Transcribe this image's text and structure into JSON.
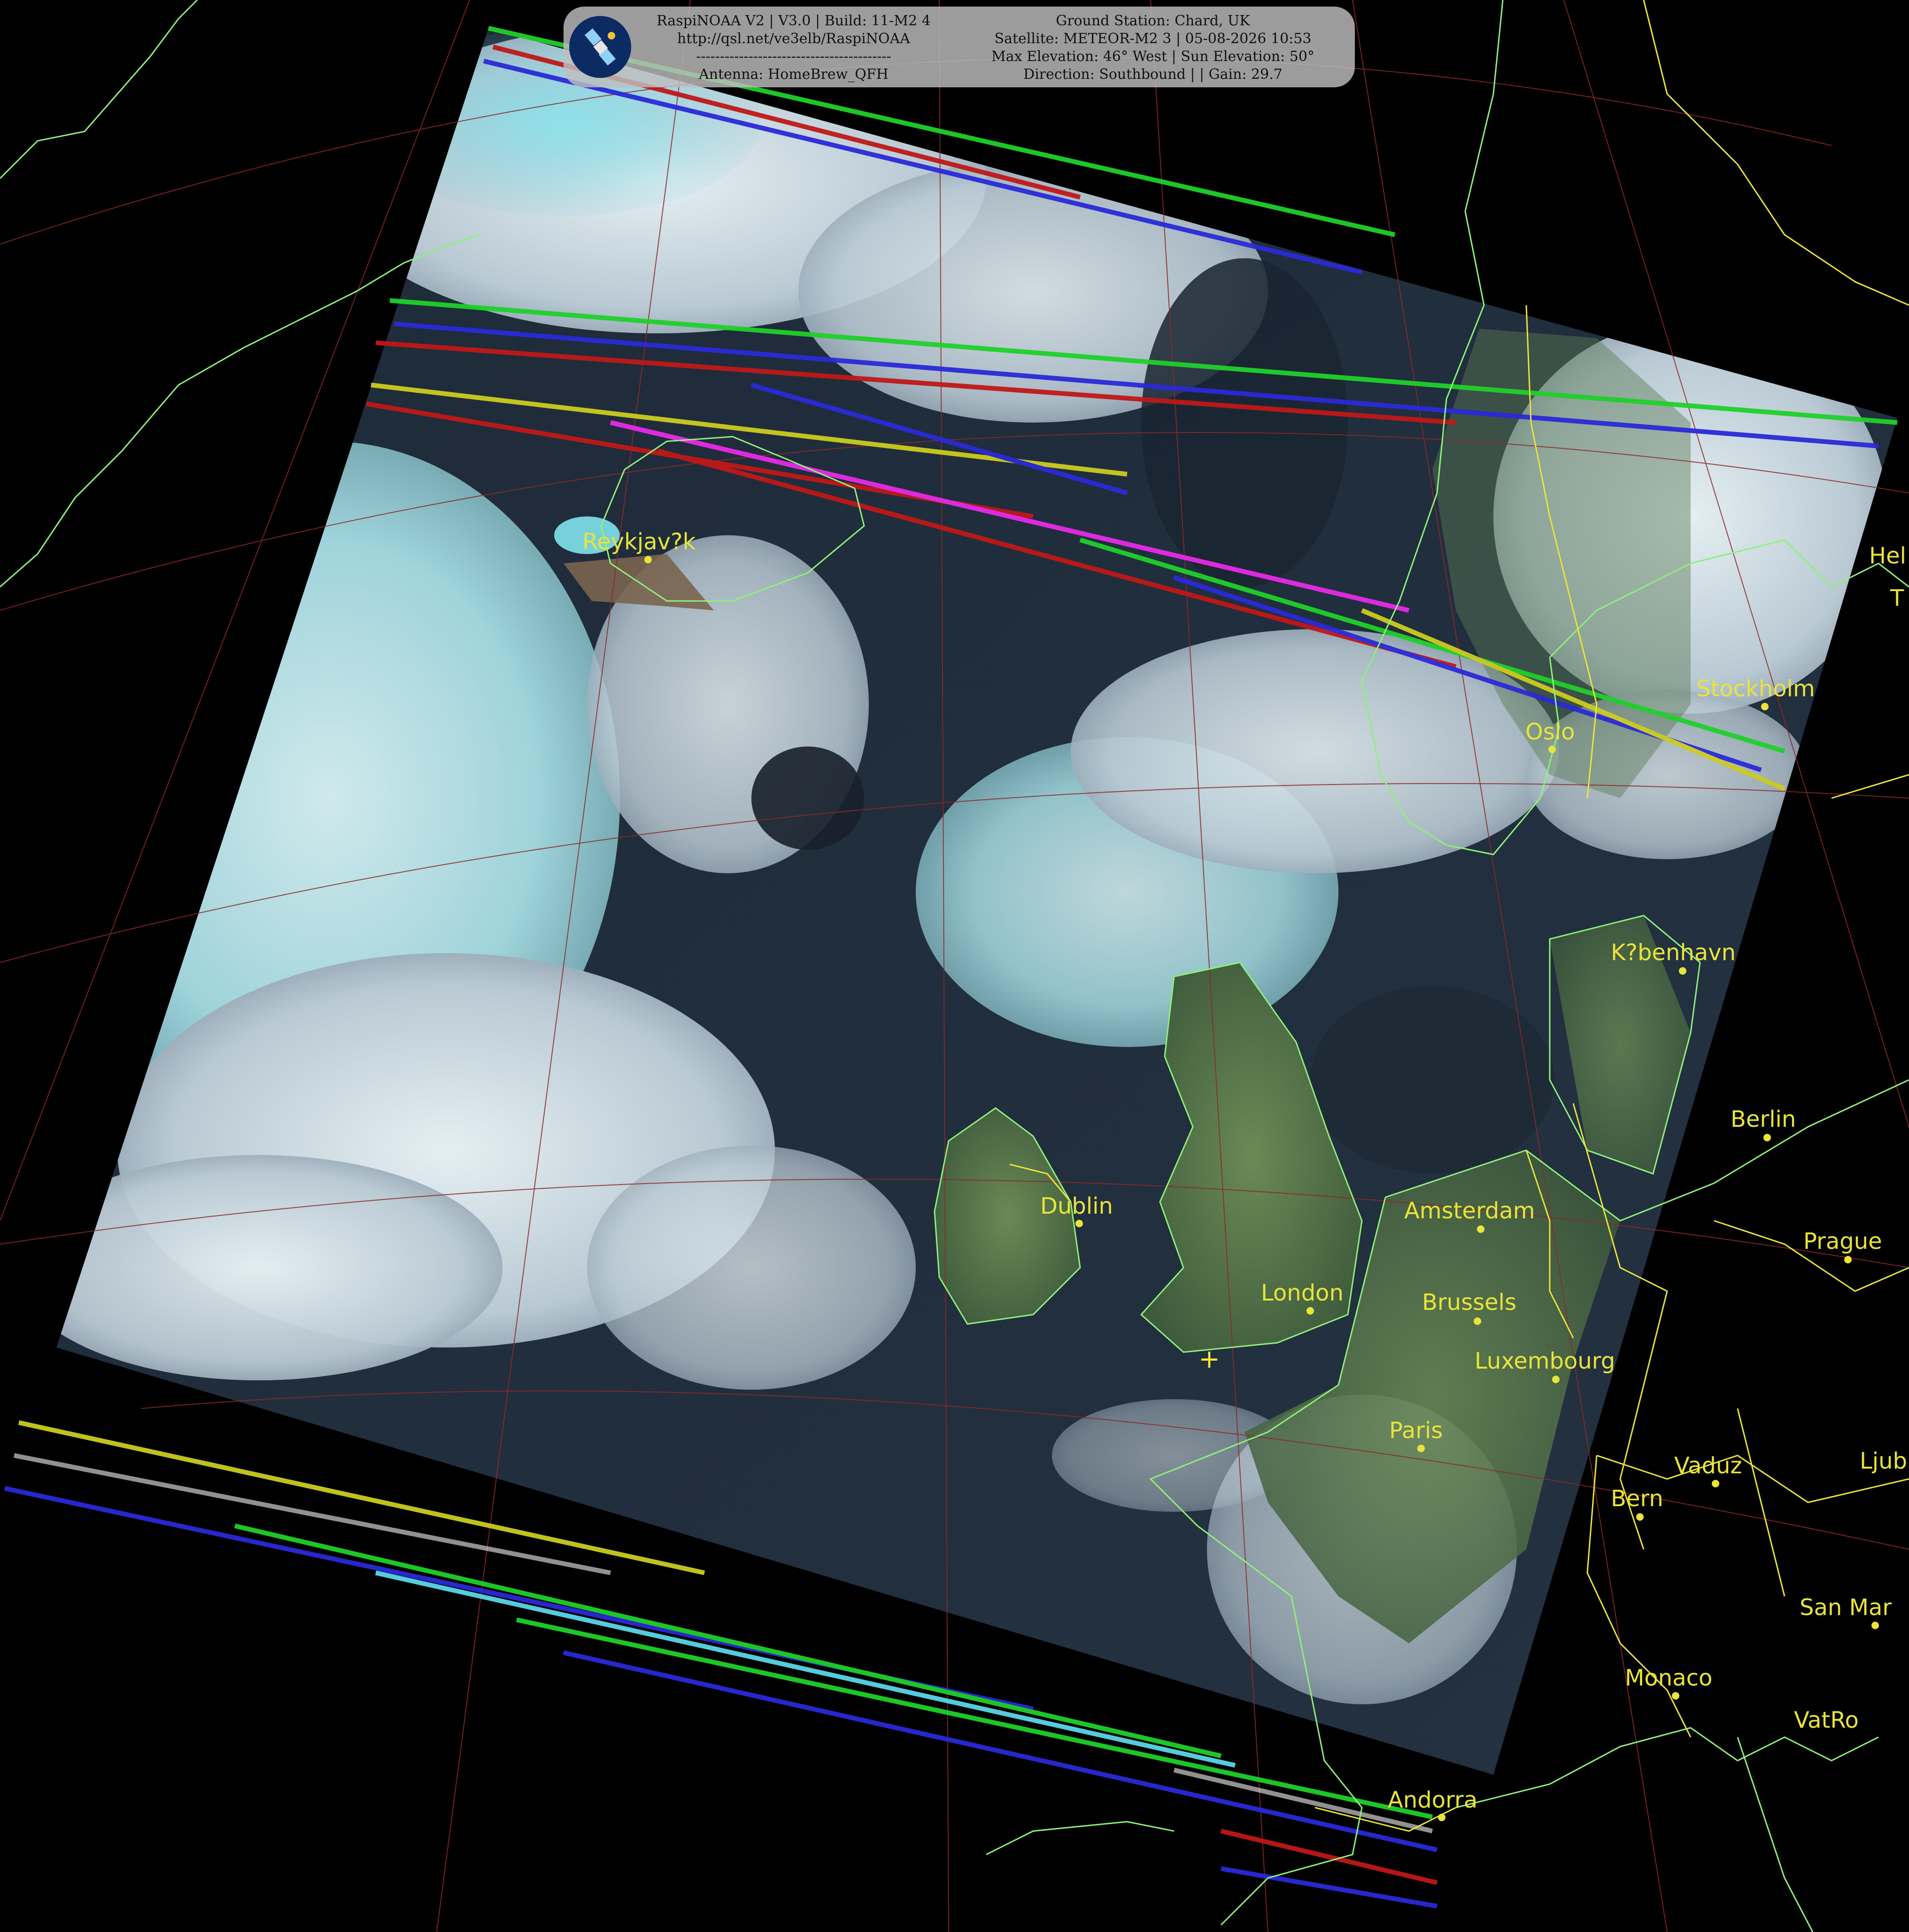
{
  "header": {
    "line1": "RaspiNOAA V2 | V3.0 | Build: 11-M2 4",
    "line2": "http://qsl.net/ve3elb/RaspiNOAA",
    "line3": "-----------------------------------------",
    "line4": "Antenna: HomeBrew_QFH",
    "station": "Ground Station: Chard, UK",
    "satellite": "Satellite: METEOR-M2 3 | 05-08-2026 10:53",
    "elevation": "Max Elevation: 46° West | Sun Elevation: 50°",
    "direction": "Direction: Southbound | | Gain: 29.7",
    "logo_icon": "satellite-icon"
  },
  "cities": [
    {
      "name": "Reykjav?k"
    },
    {
      "name": "Oslo"
    },
    {
      "name": "Stockholm"
    },
    {
      "name": "K?benhavn"
    },
    {
      "name": "Dublin"
    },
    {
      "name": "Amsterdam"
    },
    {
      "name": "London"
    },
    {
      "name": "Brussels"
    },
    {
      "name": "Luxembourg"
    },
    {
      "name": "Paris"
    },
    {
      "name": "Berlin"
    },
    {
      "name": "Prague"
    },
    {
      "name": "Vaduz"
    },
    {
      "name": "Bern"
    },
    {
      "name": "Ljub"
    },
    {
      "name": "San Mar"
    },
    {
      "name": "Monaco"
    },
    {
      "name": "VatRo"
    },
    {
      "name": "Andorra"
    },
    {
      "name": "Hel"
    },
    {
      "name": "T"
    }
  ],
  "colors": {
    "background": "#000000",
    "coastline": "#8ef07a",
    "border": "#e8e43a",
    "graticule": "#8a2a2a",
    "city": "#e8e43a",
    "cloud": "#b8dce0",
    "ocean": "#1c2430"
  },
  "ground_station_marker": "+"
}
